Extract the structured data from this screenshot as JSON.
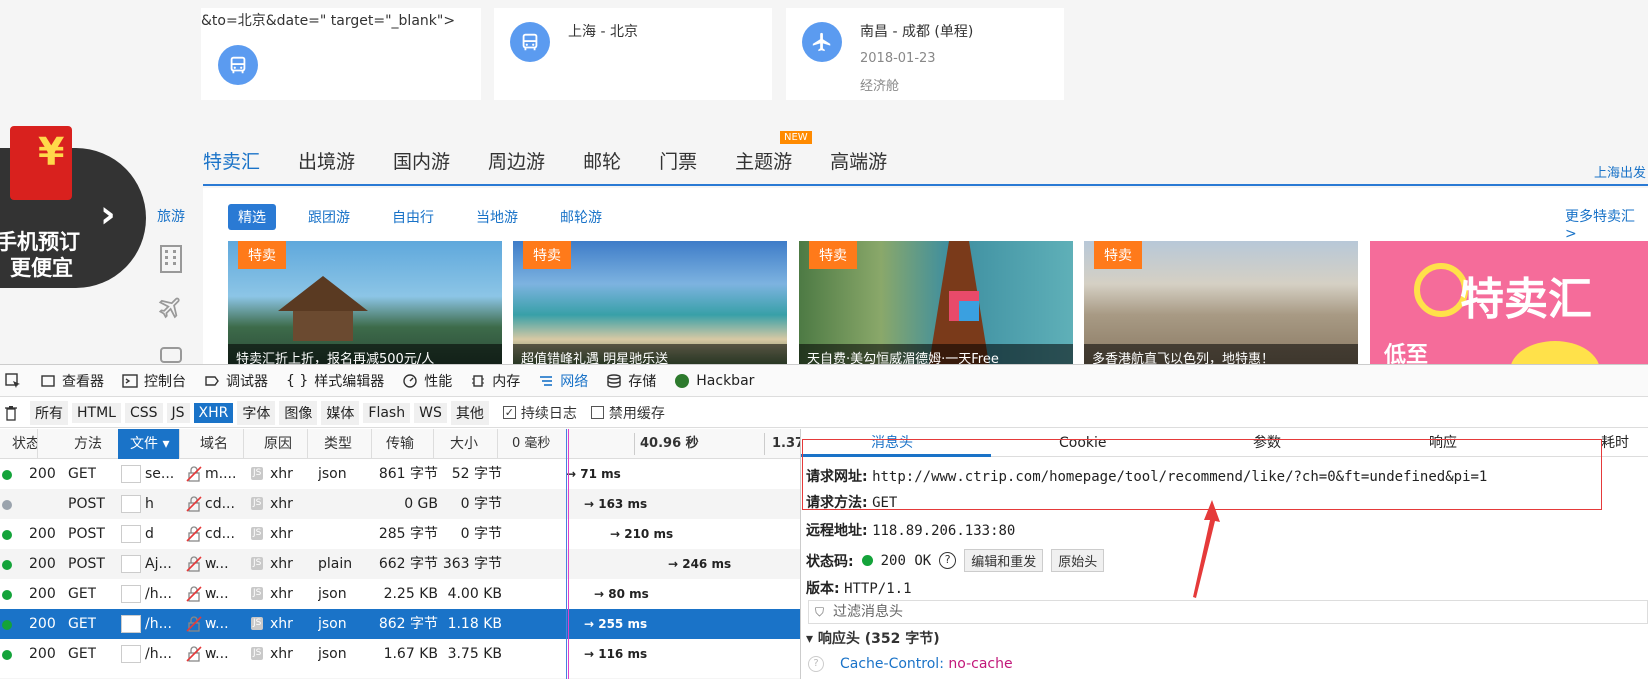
{
  "cards": {
    "card1_partial": "&to=北京&date=\" target=\"_blank\">",
    "card2_title": "上海 - 北京",
    "card3_title": "南昌 - 成都 (单程)",
    "card3_date": "2018-01-23",
    "card3_class": "经济舱"
  },
  "phone_promo": {
    "line1": "手机预订",
    "line2": "更便宜"
  },
  "sidebar_label": "旅游",
  "category_tabs": [
    "特卖汇",
    "出境游",
    "国内游",
    "周边游",
    "邮轮",
    "门票",
    "主题游",
    "高端游"
  ],
  "new_badge": "NEW",
  "origin_link": "上海出发",
  "sub_tabs": [
    "精选",
    "跟团游",
    "自由行",
    "当地游",
    "邮轮游"
  ],
  "more_link": "更多特卖汇 >",
  "deals": [
    {
      "tag": "特卖",
      "caption": "特卖汇折上折，报名再减500元/人"
    },
    {
      "tag": "特卖",
      "caption": "超值错峰礼遇 明星驰乐送"
    },
    {
      "tag": "特卖",
      "caption": "天自费·美勾恒威湄德姆·一天Free"
    },
    {
      "tag": "特卖",
      "caption": "多香港航直飞以色列，地特惠！"
    }
  ],
  "banner_text": "特卖汇",
  "banner_sub": "低至",
  "devtools": {
    "tools": [
      "查看器",
      "控制台",
      "调试器",
      "样式编辑器",
      "性能",
      "内存",
      "网络",
      "存储",
      "Hackbar"
    ],
    "active_tool": "网络",
    "filters": [
      "所有",
      "HTML",
      "CSS",
      "JS",
      "XHR",
      "字体",
      "图像",
      "媒体",
      "Flash",
      "WS",
      "其他"
    ],
    "active_filter": "XHR",
    "persist_log": "持续日志",
    "disable_cache": "禁用缓存",
    "columns": [
      "状态",
      "方法",
      "文件",
      "域名",
      "原因",
      "类型",
      "传输",
      "大小"
    ],
    "timeline": {
      "t0": "0 毫秒",
      "t1": "40.96 秒",
      "t2": "1.37"
    },
    "rows": [
      {
        "status": "200",
        "method": "GET",
        "file": "se...",
        "domain": "m....",
        "cause": "xhr",
        "type": "json",
        "transfer": "861 字节",
        "size": "52 字节",
        "time": "→ 71 ms"
      },
      {
        "status": "",
        "method": "POST",
        "file": "h",
        "domain": "cd...",
        "cause": "xhr",
        "type": "",
        "transfer": "0 GB",
        "size": "0 字节",
        "time": "→ 163 ms"
      },
      {
        "status": "200",
        "method": "POST",
        "file": "d",
        "domain": "cd...",
        "cause": "xhr",
        "type": "",
        "transfer": "285 字节",
        "size": "0 字节",
        "time": "→ 210 ms"
      },
      {
        "status": "200",
        "method": "POST",
        "file": "Aj...",
        "domain": "w...",
        "cause": "xhr",
        "type": "plain",
        "transfer": "662 字节",
        "size": "363 字节",
        "time": "→ 246 ms"
      },
      {
        "status": "200",
        "method": "GET",
        "file": "/h...",
        "domain": "w...",
        "cause": "xhr",
        "type": "json",
        "transfer": "2.25 KB",
        "size": "4.00 KB",
        "time": "→ 80 ms"
      },
      {
        "status": "200",
        "method": "GET",
        "file": "/h...",
        "domain": "w...",
        "cause": "xhr",
        "type": "json",
        "transfer": "862 字节",
        "size": "1.18 KB",
        "time": "→ 255 ms"
      },
      {
        "status": "200",
        "method": "GET",
        "file": "/h...",
        "domain": "w...",
        "cause": "xhr",
        "type": "json",
        "transfer": "1.67 KB",
        "size": "3.75 KB",
        "time": "→ 116 ms"
      }
    ],
    "details": {
      "tabs": [
        "消息头",
        "Cookie",
        "参数",
        "响应",
        "耗时"
      ],
      "request_url_label": "请求网址:",
      "request_url": "http://www.ctrip.com/homepage/tool/recommend/like/?ch=0&ft=undefined&pi=1",
      "method_label": "请求方法:",
      "method": "GET",
      "remote_label": "远程地址:",
      "remote": "118.89.206.133:80",
      "status_label": "状态码:",
      "status": "200 OK",
      "edit_resend": "编辑和重发",
      "raw_headers": "原始头",
      "version_label": "版本:",
      "version": "HTTP/1.1",
      "filter_placeholder": "过滤消息头",
      "response_headers": "响应头 (352 字节)",
      "cache_control_key": "Cache-Control:",
      "cache_control_val": "no-cache"
    }
  }
}
